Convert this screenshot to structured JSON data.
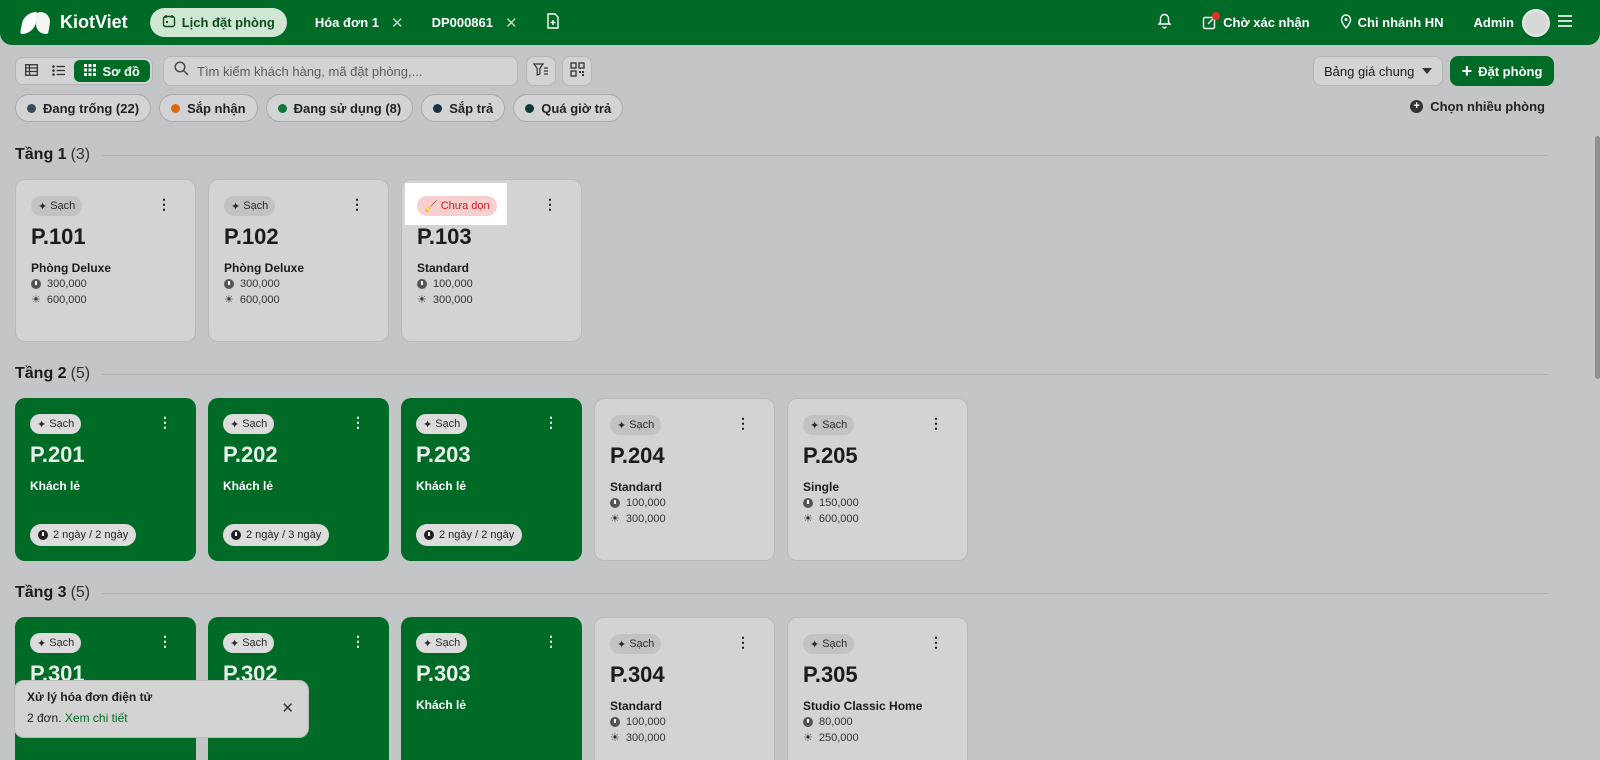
{
  "app": {
    "name": "KiotViet"
  },
  "tabs": [
    {
      "label": "Lịch đặt phòng",
      "active": true
    },
    {
      "label": "Hóa đơn 1",
      "closable": true
    },
    {
      "label": "DP000861",
      "closable": true
    }
  ],
  "header": {
    "pending_label": "Chờ xác nhận",
    "branch_label": "Chi nhánh HN",
    "user_label": "Admin"
  },
  "toolbar": {
    "view_active_label": "Sơ đồ",
    "search_placeholder": "Tìm kiếm khách hàng, mã đặt phòng,...",
    "price_select": "Bảng giá chung",
    "book_label": "Đặt phòng"
  },
  "filters": [
    {
      "label": "Đang trống (22)",
      "color": "#3a4a5a"
    },
    {
      "label": "Sắp nhận",
      "color": "#e06a10"
    },
    {
      "label": "Đang sử dụng (8)",
      "color": "#0b7a34"
    },
    {
      "label": "Sắp trả",
      "color": "#18324a"
    },
    {
      "label": "Quá giờ trả",
      "color": "#0f3a3a"
    }
  ],
  "multi_select_label": "Chọn nhiều phòng",
  "floors": [
    {
      "name": "Tầng 1",
      "count": "(3)"
    },
    {
      "name": "Tầng 2",
      "count": "(5)"
    },
    {
      "name": "Tầng 3",
      "count": "(5)"
    }
  ],
  "rooms": {
    "p101": {
      "status": "Sạch",
      "name": "P.101",
      "type": "Phòng Deluxe",
      "hour": "300,000",
      "day": "600,000"
    },
    "p102": {
      "status": "Sạch",
      "name": "P.102",
      "type": "Phòng Deluxe",
      "hour": "300,000",
      "day": "600,000"
    },
    "p103": {
      "status": "Chưa dọn",
      "name": "P.103",
      "type": "Standard",
      "hour": "100,000",
      "day": "300,000"
    },
    "p201": {
      "status": "Sạch",
      "name": "P.201",
      "guest": "Khách lẻ",
      "stay": "2 ngày / 2 ngày"
    },
    "p202": {
      "status": "Sạch",
      "name": "P.202",
      "guest": "Khách lẻ",
      "stay": "2 ngày / 3 ngày"
    },
    "p203": {
      "status": "Sạch",
      "name": "P.203",
      "guest": "Khách lẻ",
      "stay": "2 ngày / 2 ngày"
    },
    "p204": {
      "status": "Sạch",
      "name": "P.204",
      "type": "Standard",
      "hour": "100,000",
      "day": "300,000"
    },
    "p205": {
      "status": "Sạch",
      "name": "P.205",
      "type": "Single",
      "hour": "150,000",
      "day": "600,000"
    },
    "p301": {
      "status": "Sạch",
      "name": "P.301"
    },
    "p302": {
      "status": "Sạch",
      "name": "P.302"
    },
    "p303": {
      "status": "Sạch",
      "name": "P.303",
      "guest": "Khách lẻ"
    },
    "p304": {
      "status": "Sạch",
      "name": "P.304",
      "type": "Standard",
      "hour": "100,000",
      "day": "300,000"
    },
    "p305": {
      "status": "Sạch",
      "name": "P.305",
      "type": "Studio Classic Home",
      "hour": "80,000",
      "day": "250,000"
    }
  },
  "toast": {
    "title": "Xử lý hóa đơn điện tử",
    "body": "2 đơn.",
    "link": "Xem chi tiết"
  },
  "colors": {
    "brand": "#006b26",
    "dirty": "#c32020"
  }
}
